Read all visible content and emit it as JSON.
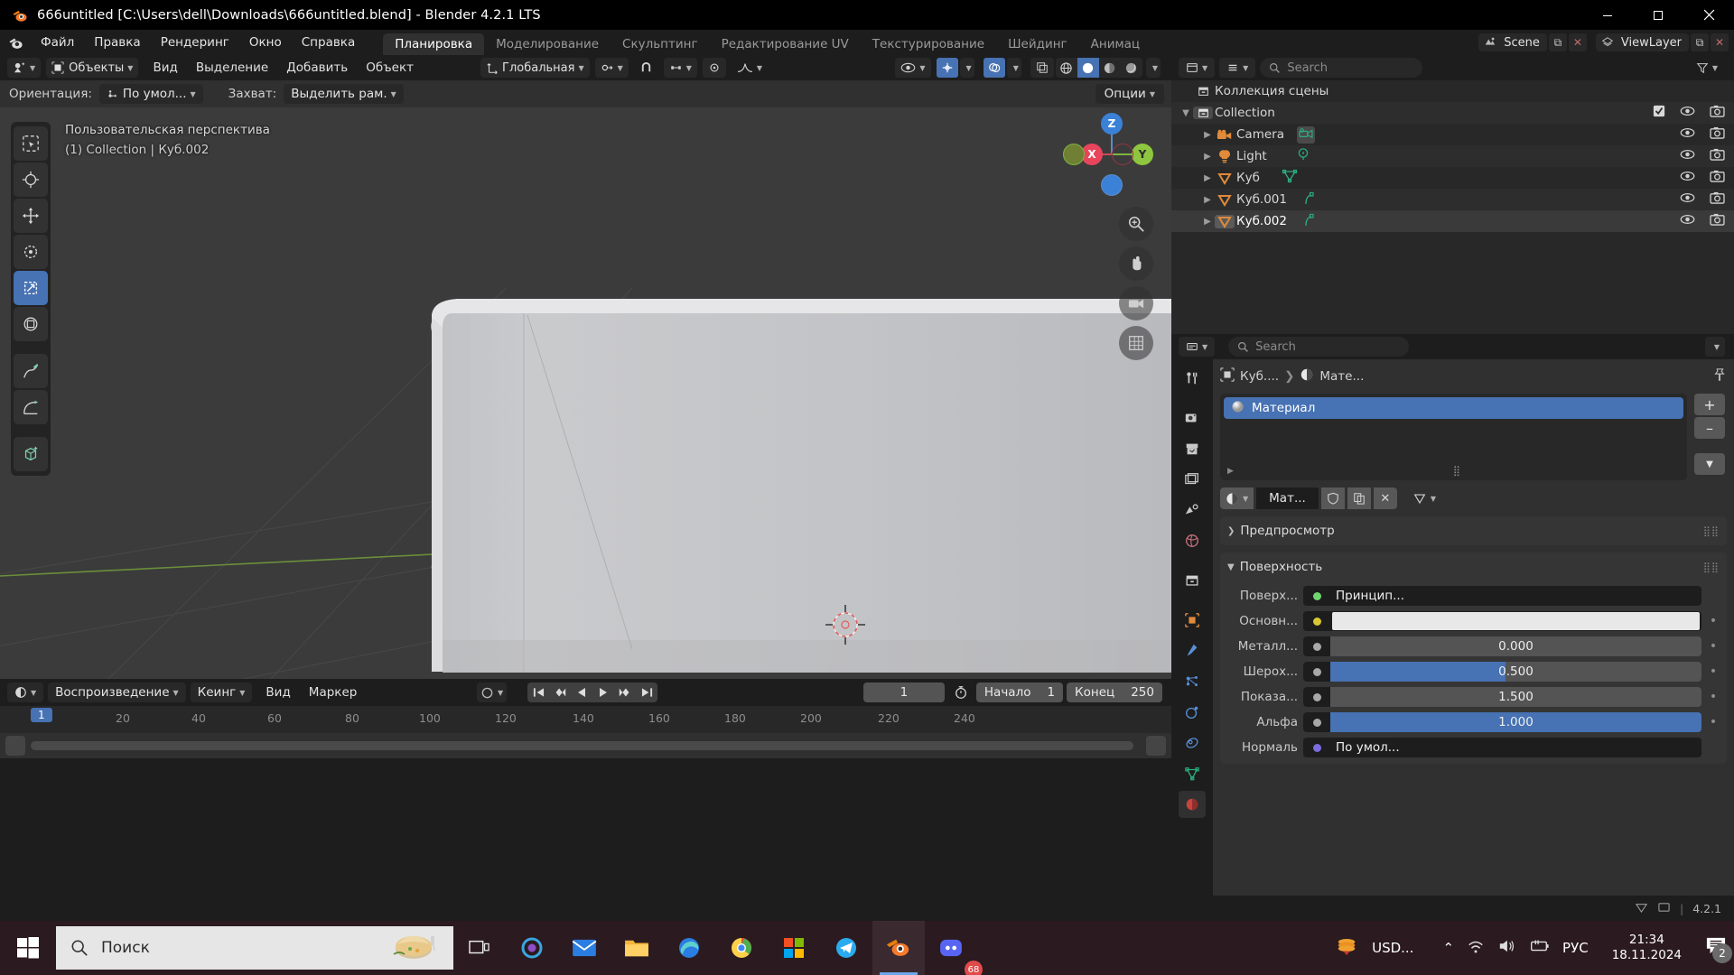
{
  "window": {
    "title": "666untitled [C:\\Users\\dell\\Downloads\\666untitled.blend] - Blender 4.2.1 LTS",
    "minimize": "—",
    "maximize": "▢",
    "close": "✕",
    "icon": "blender-logo-icon"
  },
  "topbar": {
    "menus": [
      "Файл",
      "Правка",
      "Рендеринг",
      "Окно",
      "Справка"
    ],
    "workspaces": [
      "Планировка",
      "Моделирование",
      "Скульптинг",
      "Редактирование UV",
      "Текстурирование",
      "Шейдинг",
      "Анимац"
    ],
    "active_workspace": "Планировка",
    "scene_name": "Scene",
    "viewlayer_name": "ViewLayer"
  },
  "viewport_header": {
    "mode": "Объекты",
    "menus": [
      "Вид",
      "Выделение",
      "Добавить",
      "Объект"
    ],
    "transform_orientation": "Глобальная"
  },
  "tool_settings": {
    "orientation_label": "Ориентация:",
    "orientation_value": "По умол...",
    "snap_label": "Захват:",
    "snap_value": "Выделить рам.",
    "options": "Опции"
  },
  "viewport": {
    "view_name": "Пользовательская перспектива",
    "active_object": "(1) Collection | Куб.002",
    "gizmo_axes": [
      "X",
      "Y",
      "Z"
    ],
    "tools": [
      "tweak-select-icon",
      "cursor-icon",
      "move-icon",
      "rotate-icon",
      "scale-icon",
      "transform-icon",
      "annotate-icon",
      "measure-icon",
      "add-cube-icon"
    ],
    "selected_tool_index": 4
  },
  "outliner": {
    "search_placeholder": "Search",
    "scene_collection": "Коллекция сцены",
    "rows": [
      {
        "name": "Collection",
        "icon": "collection-icon",
        "indent": 1,
        "expanded": true,
        "checkbox": true,
        "eye": true,
        "camera": true,
        "selected": false
      },
      {
        "name": "Camera",
        "icon": "camera-object-icon",
        "indent": 2,
        "expanded": false,
        "checkbox": false,
        "eye": true,
        "camera": true,
        "selected": false
      },
      {
        "name": "Light",
        "icon": "light-object-icon",
        "indent": 2,
        "expanded": false,
        "checkbox": false,
        "eye": true,
        "camera": true,
        "selected": false
      },
      {
        "name": "Куб",
        "icon": "mesh-object-icon",
        "indent": 2,
        "expanded": false,
        "checkbox": false,
        "eye": true,
        "camera": true,
        "selected": false
      },
      {
        "name": "Куб.001",
        "icon": "mesh-object-icon",
        "indent": 2,
        "expanded": false,
        "checkbox": false,
        "eye": true,
        "camera": true,
        "selected": false
      },
      {
        "name": "Куб.002",
        "icon": "mesh-object-icon",
        "indent": 2,
        "expanded": false,
        "checkbox": false,
        "eye": true,
        "camera": true,
        "selected": true
      }
    ]
  },
  "properties": {
    "search_placeholder": "Search",
    "breadcrumb_object": "Куб....",
    "breadcrumb_material": "Мате...",
    "slot_name": "Материал",
    "add_slot": "+",
    "remove_slot": "–",
    "material_selector_name": "Мат...",
    "panels": {
      "preview": "Предпросмотр",
      "surface": "Поверхность"
    },
    "rows": [
      {
        "label": "Поверх...",
        "value": "Принцип...",
        "type": "enum",
        "dot_color": "#6fd66f",
        "fill": 0
      },
      {
        "label": "Основн...",
        "value": "",
        "type": "color",
        "dot_color": "#d8c832",
        "swatch": "#e8e8e8",
        "fill": 0
      },
      {
        "label": "Металл...",
        "value": "0.000",
        "type": "slider",
        "dot_color": "#a8a8a8",
        "fill": 0
      },
      {
        "label": "Шерох...",
        "value": "0.500",
        "type": "slider",
        "dot_color": "#a8a8a8",
        "fill": 50
      },
      {
        "label": "Показа...",
        "value": "1.500",
        "type": "slider",
        "dot_color": "#a8a8a8",
        "fill": 0
      },
      {
        "label": "Альфа",
        "value": "1.000",
        "type": "slider",
        "dot_color": "#a8a8a8",
        "fill": 100
      },
      {
        "label": "Нормаль",
        "value": "По умол...",
        "type": "enum",
        "dot_color": "#7b6de0",
        "fill": 0
      }
    ],
    "tabs": [
      "tool-icon",
      "render-icon",
      "output-icon",
      "viewlayer-icon",
      "scene-icon",
      "world-icon",
      "collection-icon",
      "object-icon",
      "modifier-icon",
      "particles-icon",
      "physics-icon",
      "constraint-icon",
      "data-icon",
      "material-icon"
    ],
    "active_tab": "material-icon"
  },
  "timeline": {
    "menus": [
      "Воспроизведение",
      "Кеинг",
      "Вид",
      "Маркер"
    ],
    "current_frame": "1",
    "start_label": "Начало",
    "start_value": "1",
    "end_label": "Конец",
    "end_value": "250",
    "ticks": [
      "20",
      "40",
      "60",
      "80",
      "100",
      "120",
      "140",
      "160",
      "180",
      "200",
      "220",
      "240"
    ],
    "playhead_label": "1"
  },
  "statusbar": {
    "version": "4.2.1"
  },
  "taskbar": {
    "search_placeholder": "Поиск",
    "apps": [
      "task-view-icon",
      "cortana-icon",
      "mail-icon",
      "explorer-icon",
      "edge-icon",
      "chrome-icon",
      "store-icon",
      "telegram-icon",
      "blender-icon",
      "discord-icon"
    ],
    "active_app": "blender-icon",
    "discord_badge": "68",
    "tray_currency": "USD...",
    "tray_language": "РУС",
    "time": "21:34",
    "date": "18.11.2024",
    "notification_count": "2"
  },
  "colors": {
    "accent": "#4772b3",
    "header": "#1d1d1d",
    "panel": "#303030",
    "viewport": "#3b3b3b",
    "taskbar": "#2b1a1f"
  }
}
